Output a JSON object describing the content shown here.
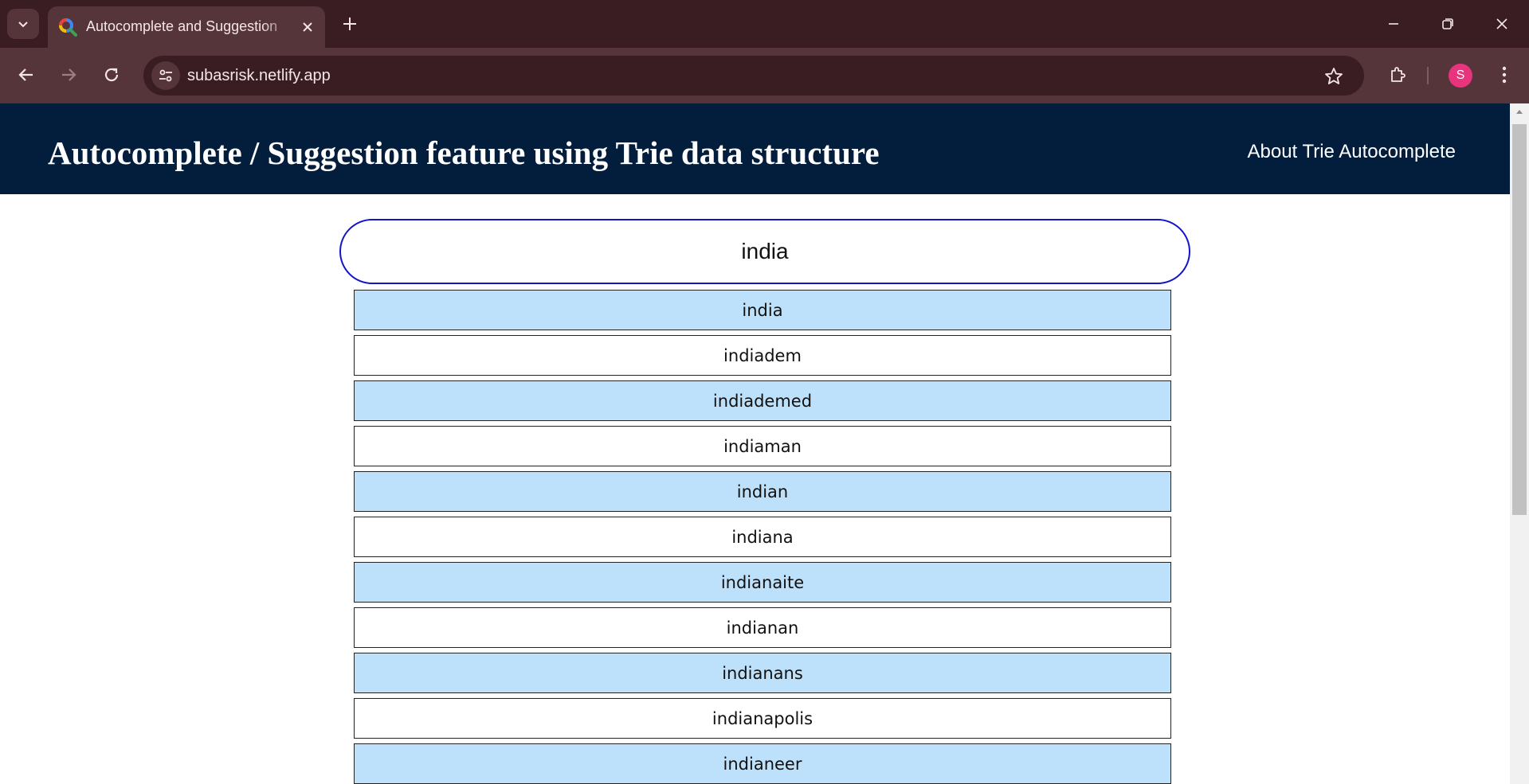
{
  "browser": {
    "tab_title": "Autocomplete and Suggestion",
    "url": "subasrisk.netlify.app",
    "profile_initial": "S",
    "colors": {
      "frame": "#3a1d22",
      "toolbar": "#55343a",
      "avatar": "#e8347c"
    }
  },
  "header": {
    "title": "Autocomplete / Suggestion feature using Trie data structure",
    "about_link": "About Trie Autocomplete",
    "background": "#031e3c"
  },
  "search": {
    "value": "india",
    "border_color": "#1414c8"
  },
  "suggestions": [
    "india",
    "indiadem",
    "indiademed",
    "indiaman",
    "indian",
    "indiana",
    "indianaite",
    "indianan",
    "indianans",
    "indianapolis",
    "indianeer"
  ],
  "suggestion_colors": {
    "highlight": "#bde1fb",
    "plain": "#ffffff"
  }
}
